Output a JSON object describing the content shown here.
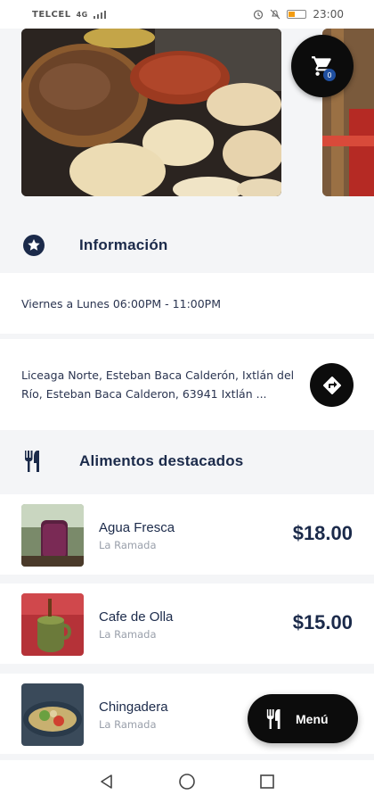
{
  "status_bar": {
    "carrier": "TELCEL",
    "network": "4G",
    "time": "23:00"
  },
  "hero": {
    "cart_badge": "0"
  },
  "info_section": {
    "title": "Información",
    "hours": "Viernes a Lunes 06:00PM - 11:00PM",
    "address": "Liceaga Norte, Esteban Baca Calderón, Ixtlán del Río, Esteban Baca Calderon, 63941 Ixtlán ..."
  },
  "featured_section": {
    "title": "Alimentos destacados",
    "items": [
      {
        "name": "Agua Fresca",
        "place": "La Ramada",
        "price": "$18.00"
      },
      {
        "name": "Cafe de Olla",
        "place": "La Ramada",
        "price": "$15.00"
      },
      {
        "name": "Chingadera",
        "place": "La Ramada",
        "price": ""
      }
    ]
  },
  "menu_button": {
    "label": "Menú"
  },
  "colors": {
    "primary_text": "#1b2a4a",
    "fab_background": "#0c0c0c",
    "page_background": "#f4f5f7",
    "secondary_text": "#9aa0ab"
  },
  "icons": {
    "cart": "cart-icon",
    "info": "star-icon",
    "directions": "directions-icon",
    "featured": "fork-knife-icon",
    "menu": "fork-knife-icon"
  }
}
